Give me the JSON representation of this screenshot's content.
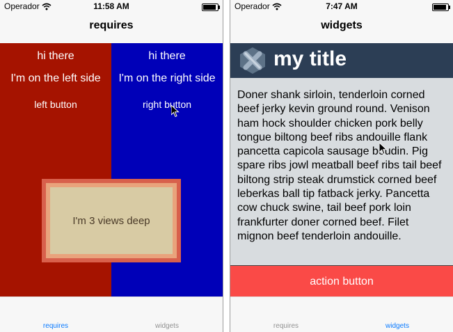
{
  "left_screen": {
    "status_bar": {
      "carrier": "Operador",
      "time": "11:58 AM"
    },
    "nav_title": "requires",
    "left_panel": {
      "greeting": "hi there",
      "side_text": "I'm on the left side",
      "button_label": "left button"
    },
    "right_panel": {
      "greeting": "hi there",
      "side_text": "I'm on the right side",
      "button_label": "right button"
    },
    "nested_label": "I'm 3 views deep",
    "tabs": [
      {
        "label": "requires",
        "active": true
      },
      {
        "label": "widgets",
        "active": false
      }
    ]
  },
  "right_screen": {
    "status_bar": {
      "carrier": "Operador",
      "time": "7:47 AM"
    },
    "nav_title": "widgets",
    "header_title": "my title",
    "body_text": "Doner shank sirloin, tenderloin corned beef jerky kevin ground round. Venison ham hock shoulder chicken pork belly tongue biltong beef ribs andouille flank pancetta capicola sausage boudin. Pig spare ribs jowl meatball beef ribs tail beef biltong strip steak drumstick corned beef leberkas ball tip fatback jerky. Pancetta cow chuck swine, tail beef pork loin frankfurter doner corned beef. Filet mignon beef tenderloin andouille.",
    "action_button": "action button",
    "tabs": [
      {
        "label": "requires",
        "active": false
      },
      {
        "label": "widgets",
        "active": true
      }
    ]
  },
  "colors": {
    "left_panel": "#a51300",
    "right_panel": "#0000b8",
    "title_bar": "#2c3e55",
    "action_button": "#fa4a47",
    "tab_active": "#0a7aff"
  },
  "icons": [
    "wifi-icon",
    "battery-icon",
    "logo-icon",
    "mouse-cursor-icon"
  ]
}
